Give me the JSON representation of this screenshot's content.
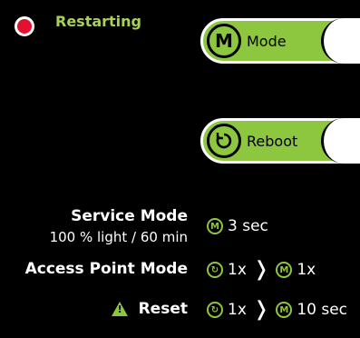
{
  "status": {
    "text": "Restarting",
    "dot_color": "#e3112f"
  },
  "buttons": {
    "mode": {
      "icon_letter": "M",
      "label": "Mode"
    },
    "reboot": {
      "icon": "restart-icon",
      "label": "Reboot"
    }
  },
  "instructions": {
    "service": {
      "title": "Service Mode",
      "subtitle": "100 % light / 60 min",
      "value": "3 sec"
    },
    "access": {
      "title": "Access Point Mode",
      "value_left": "1x",
      "value_right": "1x"
    },
    "reset": {
      "title": "Reset",
      "value_left": "1x",
      "value_right": "10 sec"
    }
  },
  "colors": {
    "accent": "#8dc63f",
    "text": "#ffffff",
    "background": "#000000",
    "status_text": "#a8d155"
  }
}
